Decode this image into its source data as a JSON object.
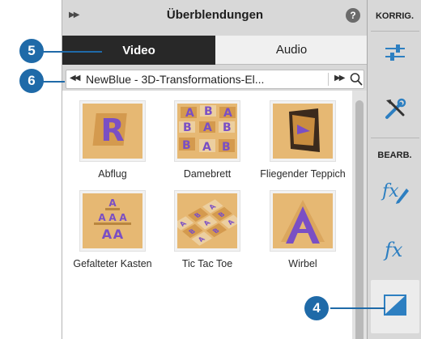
{
  "panel": {
    "title": "Überblendungen",
    "help_glyph": "?",
    "tabs": [
      {
        "label": "Video",
        "active": true
      },
      {
        "label": "Audio",
        "active": false
      }
    ],
    "category": "NewBlue - 3D-Transformations-El..."
  },
  "transitions": [
    {
      "label": "Abflug",
      "icon": "abflug-thumbnail"
    },
    {
      "label": "Damebrett",
      "icon": "damebrett-thumbnail"
    },
    {
      "label": "Fliegender Teppich",
      "icon": "fliegender-teppich-thumbnail"
    },
    {
      "label": "Gefalteter Kasten",
      "icon": "gefalteter-kasten-thumbnail"
    },
    {
      "label": "Tic Tac Toe",
      "icon": "tic-tac-toe-thumbnail"
    },
    {
      "label": "Wirbel",
      "icon": "wirbel-thumbnail"
    }
  ],
  "toolbar": {
    "korrig_label": "KORRIG.",
    "bearb_label": "BEARB.",
    "buttons": [
      {
        "icon": "adjustments-sliders-icon"
      },
      {
        "icon": "tools-icon"
      },
      {
        "icon": "applied-effects-icon"
      },
      {
        "icon": "effects-icon"
      },
      {
        "icon": "transitions-icon"
      }
    ]
  },
  "callouts": [
    "5",
    "6",
    "4"
  ],
  "colors": {
    "callout": "#1f6aa8",
    "active_tab": "#282828",
    "thumbnail_bg": "#e6b873",
    "glyph_purple": "#7a4fc4",
    "toolbar_icon_blue": "#2d7fc1"
  }
}
